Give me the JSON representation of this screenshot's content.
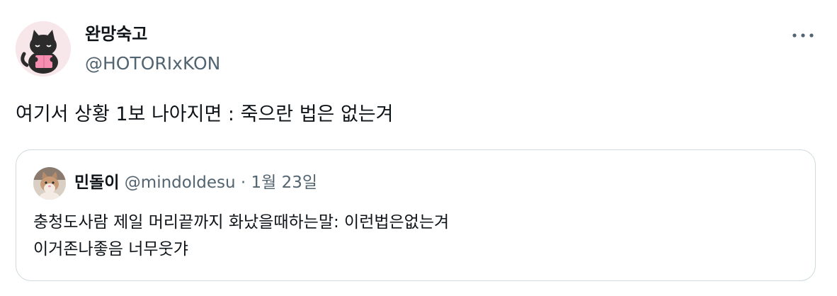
{
  "author": {
    "name": "완망숙고",
    "handle": "@HOTORIxKON"
  },
  "tweet": {
    "text": "여기서 상황 1보 나아지면 : 죽으란 법은 없는겨"
  },
  "more_icon": "more-horizontal-icon",
  "quoted": {
    "name": "민돌이",
    "handle": "@mindoldesu",
    "separator": "·",
    "date": "1월 23일",
    "lines": [
      "충청도사람 제일 머리끝까지 화났을때하는말: 이런법은없는겨",
      "이거존나좋음 너무웃갸"
    ]
  },
  "colors": {
    "text_primary": "#0f1419",
    "text_secondary": "#536471",
    "border": "#cfd9de"
  }
}
